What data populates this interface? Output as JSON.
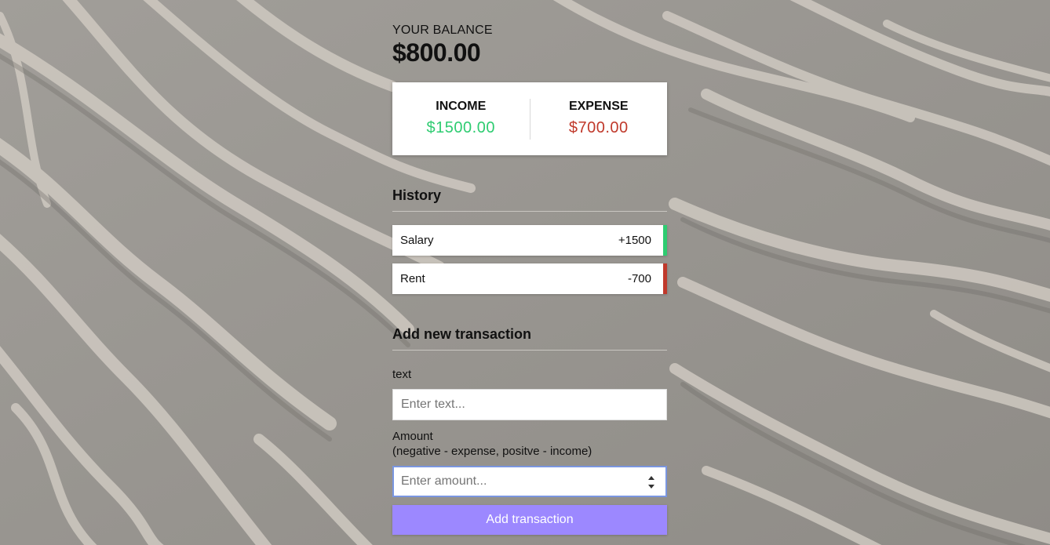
{
  "balance": {
    "label": "YOUR BALANCE",
    "amount": "$800.00"
  },
  "summary": {
    "income_label": "INCOME",
    "income_value": "$1500.00",
    "expense_label": "EXPENSE",
    "expense_value": "$700.00"
  },
  "history": {
    "title": "History",
    "items": [
      {
        "text": "Salary",
        "amount": "+1500",
        "type": "plus"
      },
      {
        "text": "Rent",
        "amount": "-700",
        "type": "minus"
      }
    ]
  },
  "form": {
    "title": "Add new transaction",
    "text_label": "text",
    "text_placeholder": "Enter text...",
    "amount_label": "Amount",
    "amount_hint": "(negative - expense, positve - income)",
    "amount_placeholder": "Enter amount...",
    "submit_label": "Add transaction"
  },
  "colors": {
    "income": "#2ecc71",
    "expense": "#c0392b",
    "button": "#9c88ff"
  }
}
